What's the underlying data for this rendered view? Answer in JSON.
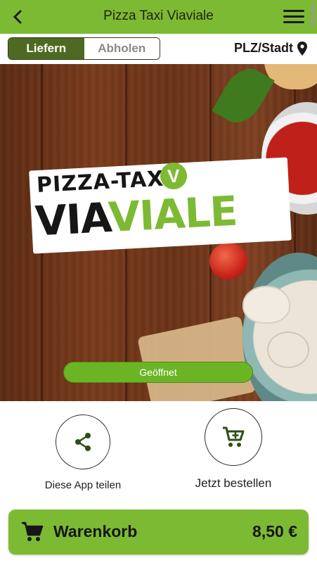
{
  "header": {
    "title": "Pizza Taxi Viaviale",
    "back_icon": "chevron-left-icon",
    "menu_icon": "hamburger-menu-icon"
  },
  "order_mode": {
    "options": [
      "Liefern",
      "Abholen"
    ],
    "selected": "Liefern"
  },
  "location": {
    "label": "PLZ/Stadt",
    "icon": "map-pin-icon"
  },
  "hero": {
    "logo_line1": "PIZZA-TAXI",
    "logo_badge": "V",
    "logo_line2_dark": "VIA",
    "logo_line2_green": "VIALE",
    "status": "Geöffnet"
  },
  "actions": {
    "share": {
      "label": "Diese App teilen",
      "icon": "share-icon"
    },
    "order": {
      "label": "Jetzt bestellen",
      "icon": "cart-add-icon"
    }
  },
  "cart": {
    "label": "Warenkorb",
    "total": "8,50 €",
    "icon": "shopping-cart-icon"
  },
  "colors": {
    "brand_green": "#7dba33",
    "dark_green": "#4e6a22",
    "status_green": "#6bb525"
  }
}
